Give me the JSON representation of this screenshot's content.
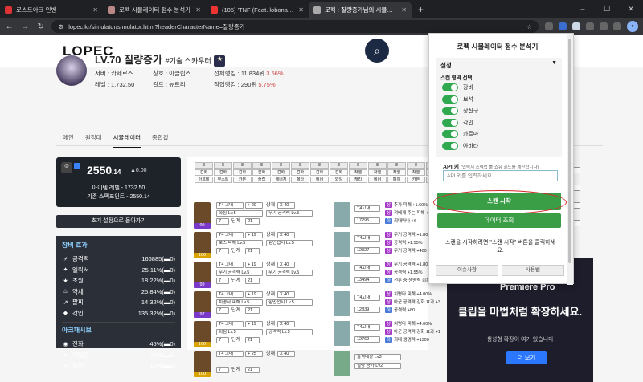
{
  "tabs": [
    {
      "title": "로스트아크 인벤",
      "color": "#d33"
    },
    {
      "title": "로펙 시뮬레이터 점수 분석기",
      "color": "#b88"
    },
    {
      "title": "(105) 'TNF (Feat. lobonabe…",
      "color": "#e33"
    },
    {
      "title": "로펙 : 질량증가님의 시뮬레이터",
      "color": "#aaa"
    }
  ],
  "browser": {
    "url": "lopec.kr/simulator/simulator.html?headerCharacterName=질량증가",
    "newtab": "+",
    "min": "–",
    "max": "☐",
    "close": "✕",
    "back": "←",
    "fwd": "→",
    "reload": "↻",
    "star": "☆"
  },
  "site": {
    "logo": "LOPEC"
  },
  "profile": {
    "name": "LV.70 질량증가",
    "cls": "#기술 스카우터",
    "badge": "★",
    "stats": [
      {
        "a": "서버 : 카제로스",
        "b": "칭호 : 이클립스",
        "c": "전체랭킹 : 11,834위",
        "cp": "3.56%"
      },
      {
        "a": "레벨 : 1,732.50",
        "b": "길드 : 뉴트리",
        "c": "직업랭킹 : 290위",
        "cp": "5.75%"
      }
    ]
  },
  "subtabs": [
    "메인",
    "원정대",
    "시뮬레이터",
    "종합값"
  ],
  "score": {
    "icon": "☺",
    "main": "2550",
    "dec": ".14",
    "change": "▲0.00",
    "ilvl": "아이템 레벨 - 1732.50",
    "base": "기존 스펙포인트 - 2550.14"
  },
  "reset": "초기 설정으로 돌아가기",
  "effects": {
    "title": "장비 효과",
    "rows": [
      {
        "icon": "⚡",
        "label": "공격력",
        "value": "166885(▬0)"
      },
      {
        "icon": "✦",
        "label": "엘릭서",
        "value": "25.11%(▬0)"
      },
      {
        "icon": "★",
        "label": "초월",
        "value": "18.22%(▬0)"
      },
      {
        "icon": "♨",
        "label": "악세",
        "value": "25.84%(▬0)"
      },
      {
        "icon": "↗",
        "label": "팔찌",
        "value": "14.32%(▬0)"
      },
      {
        "icon": "◆",
        "label": "각인",
        "value": "135.32%(▬0)"
      }
    ],
    "title2": "아크패시브",
    "rows2": [
      {
        "icon": "◉",
        "label": "진화",
        "value": "45%(▬0)"
      },
      {
        "icon": "◐",
        "label": "깨달음",
        "value": "42%(▬0)"
      },
      {
        "icon": "✈",
        "label": "도약",
        "value": "15%(▬0)"
      }
    ]
  },
  "gems": [
    [
      "8",
      "겁화",
      "아르데"
    ],
    [
      "8",
      "겁화",
      "부스트"
    ],
    [
      "8",
      "겁화",
      "카본"
    ],
    [
      "8",
      "겁화",
      "슬립"
    ],
    [
      "8",
      "겁화",
      "에너지"
    ],
    [
      "8",
      "겁화",
      "메타"
    ],
    [
      "8",
      "겁화",
      "에너"
    ],
    [
      "8",
      "겁화",
      "와일"
    ],
    [
      "8",
      "작열",
      "캐리"
    ],
    [
      "8",
      "작열",
      "에너"
    ],
    [
      "8",
      "작열",
      "페이"
    ],
    [
      "8",
      "작열",
      "카본"
    ],
    [
      "8",
      "작열",
      "에너"
    ],
    [
      "8",
      "작열",
      "기능"
    ],
    [
      "8",
      "작열",
      "아르"
    ]
  ],
  "equip": [
    {
      "grade": "T4 고대",
      "refine": "+ 20",
      "kind": "상재",
      "x": "X 40",
      "a": "화심 Lv.5",
      "b": "무기 공격력 Lv.5",
      "c": "7",
      "d": "단계",
      "e": "21",
      "q": "99",
      "qc": "#7a38c8"
    },
    {
      "grade": "T4 고대",
      "refine": "+ 19",
      "kind": "상재",
      "x": "X 40",
      "a": "보스 피해 Lv.5",
      "b": "힘민첩지 Lv.5",
      "c": "7",
      "d": "단계",
      "e": "21",
      "q": "100",
      "qc": "#d9a400"
    },
    {
      "grade": "T4 고대",
      "refine": "+ 19",
      "kind": "상재",
      "x": "X 40",
      "a": "무기 공격력 Lv.5",
      "b": "무기 공격력 Lv.5",
      "c": "7",
      "d": "단계",
      "e": "21",
      "q": "99",
      "qc": "#7a38c8"
    },
    {
      "grade": "T4 고대",
      "refine": "+ 19",
      "kind": "상재",
      "x": "X 40",
      "a": "치명타 피해 Lv.5",
      "b": "힘민첩지 Lv.5",
      "c": "7",
      "d": "단계",
      "e": "21",
      "q": "97",
      "qc": "#7a38c8"
    },
    {
      "grade": "T4 고대",
      "refine": "+ 19",
      "kind": "상재",
      "x": "X 40",
      "a": "회심 Lv.5",
      "b": "공격력 Lv.5",
      "c": "7",
      "d": "단계",
      "e": "21",
      "q": "100",
      "qc": "#d9a400"
    },
    {
      "grade": "T4 고대",
      "refine": "+ 25",
      "kind": "상재",
      "x": "X 40",
      "a": "",
      "b": "",
      "c": "7",
      "d": "단계",
      "e": "21",
      "q": "100",
      "qc": "#d9a400"
    }
  ],
  "acc": [
    {
      "grade": "T4고대",
      "v": "17295",
      "lines": [
        [
          "상",
          "#a63ac8",
          "추가 피해 +1.60%"
        ],
        [
          "상",
          "#a63ac8",
          "적에게 주는 피해 +"
        ],
        [
          "하",
          "#4a7ad8",
          "최대마나 +6"
        ]
      ]
    },
    {
      "grade": "T4고대",
      "v": "12327",
      "lines": [
        [
          "상",
          "#a63ac8",
          "무기 공격력 +1.80%"
        ],
        [
          "상",
          "#a63ac8",
          "공격력 +1.55%"
        ],
        [
          "상",
          "#a63ac8",
          "무기 공격력 +400"
        ]
      ]
    },
    {
      "grade": "T4고대",
      "v": "13494",
      "lines": [
        [
          "상",
          "#a63ac8",
          "무기 공격력 +1.80%"
        ],
        [
          "상",
          "#a63ac8",
          "공격력 +1.55%"
        ],
        [
          "하",
          "#4a7ad8",
          "전투 중 생명력 회복량 +1"
        ]
      ]
    },
    {
      "grade": "T4고대",
      "v": "12839",
      "lines": [
        [
          "상",
          "#a63ac8",
          "치명타 피해 +4.00%"
        ],
        [
          "상",
          "#a63ac8",
          "아군 공격력 강화 효과 +3"
        ],
        [
          "하",
          "#4a7ad8",
          "공격력 +80"
        ]
      ]
    },
    {
      "grade": "T4고대",
      "v": "12762",
      "lines": [
        [
          "상",
          "#a63ac8",
          "치명타 피해 +4.00%"
        ],
        [
          "상",
          "#a63ac8",
          "아군 공격력 강화 효과 +1"
        ],
        [
          "하",
          "#4a7ad8",
          "최대 생명력 +1300"
        ]
      ]
    }
  ],
  "stone": {
    "a": "돌격대장 Lv3",
    "b": "질량 증가 Lv2"
  },
  "popup": {
    "title": "로펙 시뮬레이터 점수 분석기",
    "settings": "설정",
    "arrow": "▼",
    "scan_label": "스캔 영역 선택",
    "toggles": [
      "장비",
      "보석",
      "장신구",
      "각인",
      "카르마",
      "아바타"
    ],
    "api_label": "API 키",
    "api_hint": "(입력시 스펙업 툴 쇼유 골드를 계산합니다)",
    "api_placeholder": "API 키를 입력하세요",
    "start": "스캔 시작",
    "data": "데이터 조회",
    "msg": "스캔을 시작하려면 \"스캔 시작\" 버튼을 클릭하세요.",
    "foot1": "이슈사항",
    "foot2": "사용법"
  },
  "ad": {
    "brand": "Premiere Pro",
    "headline": "클립을 마법처럼 확장하세요.",
    "sub": "생성형 확장이 여기 있습니다",
    "btn": "더 보기"
  },
  "colors": {
    "accent": "#3a9e47",
    "ring": "#d42a2a"
  }
}
